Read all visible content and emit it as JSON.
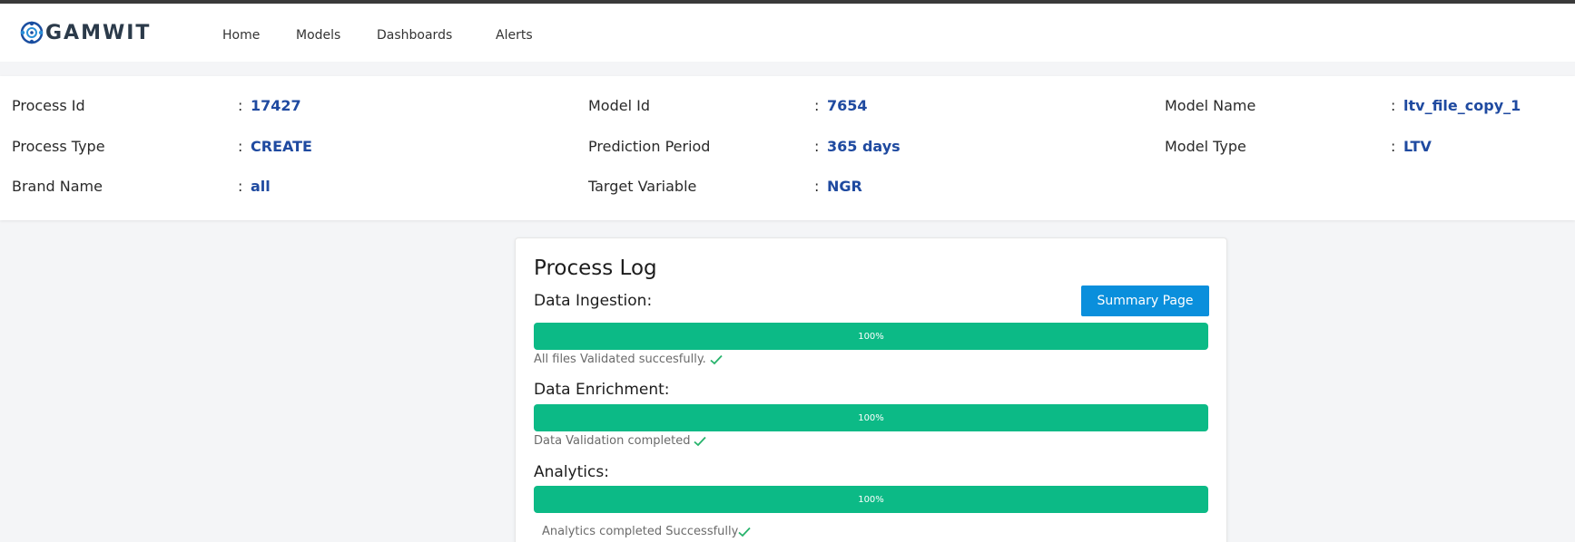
{
  "app": {
    "brand": "GAMWIT",
    "accent": "#0a8fdc",
    "progress_color": "#0cba86",
    "value_color": "#1f4aa0"
  },
  "nav": {
    "items": [
      {
        "label": "Home"
      },
      {
        "label": "Models"
      },
      {
        "label": "Dashboards"
      },
      {
        "label": "Alerts"
      }
    ]
  },
  "details": {
    "process_id": {
      "label": "Process Id",
      "value": "17427"
    },
    "process_type": {
      "label": "Process Type",
      "value": "CREATE"
    },
    "brand_name": {
      "label": "Brand Name",
      "value": "all"
    },
    "model_id": {
      "label": "Model Id",
      "value": "7654"
    },
    "prediction_period": {
      "label": "Prediction Period",
      "value": "365 days"
    },
    "target_variable": {
      "label": "Target Variable",
      "value": "NGR"
    },
    "model_name": {
      "label": "Model Name",
      "value": "ltv_file_copy_1"
    },
    "model_type": {
      "label": "Model Type",
      "value": "LTV"
    },
    "colon": ":"
  },
  "process_log": {
    "title": "Process Log",
    "summary_button": "Summary Page",
    "sections": [
      {
        "title": "Data Ingestion:",
        "progress": 100,
        "progress_label": "100%",
        "status": "All files Validated succesfully.",
        "status_icon": "check-icon"
      },
      {
        "title": "Data Enrichment:",
        "progress": 100,
        "progress_label": "100%",
        "status": "Data Validation completed",
        "status_icon": "check-icon"
      },
      {
        "title": "Analytics:",
        "progress": 100,
        "progress_label": "100%",
        "status": "Analytics completed Successfully",
        "status_icon": "check-icon"
      }
    ]
  }
}
